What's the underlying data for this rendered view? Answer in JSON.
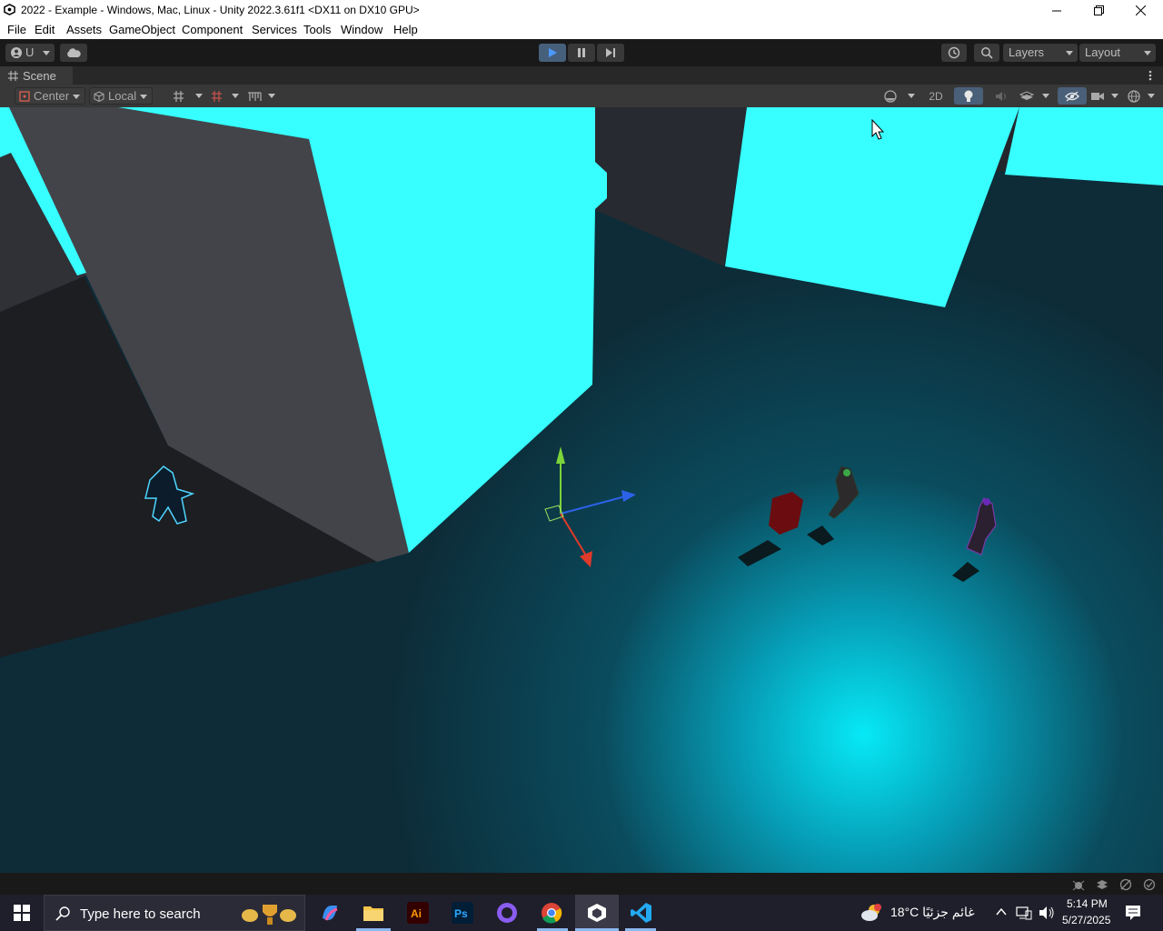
{
  "window": {
    "title": "2022 - Example - Windows, Mac, Linux - Unity 2022.3.61f1 <DX11 on DX10 GPU>"
  },
  "menu": [
    "File",
    "Edit",
    "Assets",
    "GameObject",
    "Component",
    "Services",
    "Tools",
    "Window",
    "Help"
  ],
  "toolbar": {
    "account_label": "U",
    "layers_label": "Layers",
    "layout_label": "Layout"
  },
  "scene_tab": {
    "label": "Scene"
  },
  "scene_toolbar": {
    "pivot_label": "Center",
    "space_label": "Local",
    "mode_2d_label": "2D"
  },
  "taskbar": {
    "search_placeholder": "Type here to search",
    "weather": "18°C  غائم جزئيًا",
    "time": "5:14 PM",
    "date": "5/27/2025"
  },
  "colors": {
    "cyan": "#38ffff",
    "floor": "#0b3a48",
    "accent_blue": "#2f7dd6"
  }
}
